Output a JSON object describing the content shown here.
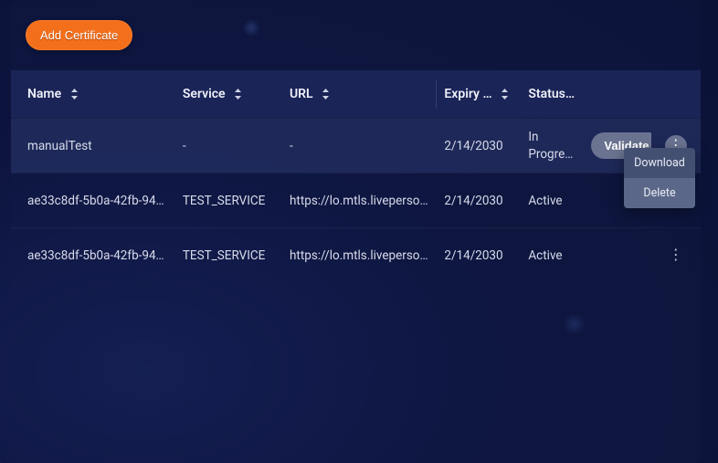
{
  "toolbar": {
    "add_label": "Add Certificate"
  },
  "columns": {
    "name": "Name",
    "service": "Service",
    "url": "URL",
    "expiry": "Expiry …",
    "status": "Status"
  },
  "rows": [
    {
      "name": "manualTest",
      "service": "-",
      "url": "-",
      "expiry": "2/14/2030",
      "status": "In Progress",
      "action_label": "Validate"
    },
    {
      "name": "ae33c8df-5b0a-42fb-94…",
      "service": "TEST_SERVICE",
      "url": "https://lo.mtls.liveperso…",
      "expiry": "2/14/2030",
      "status": "Active"
    },
    {
      "name": "ae33c8df-5b0a-42fb-94…",
      "service": "TEST_SERVICE",
      "url": "https://lo.mtls.liveperso…",
      "expiry": "2/14/2030",
      "status": "Active"
    }
  ],
  "menu": {
    "download": "Download",
    "delete": "Delete"
  }
}
